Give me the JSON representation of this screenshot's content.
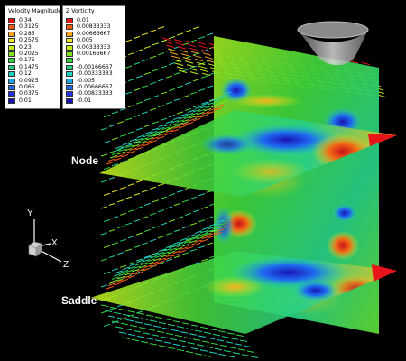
{
  "legends": {
    "velocity": {
      "title": "Velocity Magnitude",
      "entries": [
        {
          "value": "0.34",
          "color": "#e8141a"
        },
        {
          "value": "0.3125",
          "color": "#f25b14"
        },
        {
          "value": "0.285",
          "color": "#f9a31c"
        },
        {
          "value": "0.2575",
          "color": "#f2e622"
        },
        {
          "value": "0.23",
          "color": "#c2ec1e"
        },
        {
          "value": "0.2025",
          "color": "#7ee21e"
        },
        {
          "value": "0.175",
          "color": "#32d43a"
        },
        {
          "value": "0.1475",
          "color": "#22d07e"
        },
        {
          "value": "0.12",
          "color": "#1ecfc0"
        },
        {
          "value": "0.0925",
          "color": "#1aa6ea"
        },
        {
          "value": "0.065",
          "color": "#1e6af0"
        },
        {
          "value": "0.0375",
          "color": "#2232e4"
        },
        {
          "value": "0.01",
          "color": "#1a14b4"
        }
      ]
    },
    "vorticity": {
      "title": "Z Vorticity",
      "entries": [
        {
          "value": "0.01",
          "color": "#e8141a"
        },
        {
          "value": "0.00833333",
          "color": "#f25b14"
        },
        {
          "value": "0.00666667",
          "color": "#f9a31c"
        },
        {
          "value": "0.005",
          "color": "#f2e622"
        },
        {
          "value": "0.00333333",
          "color": "#c2ec1e"
        },
        {
          "value": "0.00166667",
          "color": "#7ee21e"
        },
        {
          "value": "0",
          "color": "#32d43a"
        },
        {
          "value": "-0.00166667",
          "color": "#22d07e"
        },
        {
          "value": "-0.00333333",
          "color": "#1ecfc0"
        },
        {
          "value": "-0.005",
          "color": "#1aa6ea"
        },
        {
          "value": "-0.00666667",
          "color": "#1e6af0"
        },
        {
          "value": "-0.00833333",
          "color": "#2232e4"
        },
        {
          "value": "-0.01",
          "color": "#1a14b4"
        }
      ]
    }
  },
  "labels": {
    "node": "Node",
    "saddle": "Saddle"
  },
  "axes": {
    "y": "Y",
    "x": "X",
    "z": "Z"
  }
}
